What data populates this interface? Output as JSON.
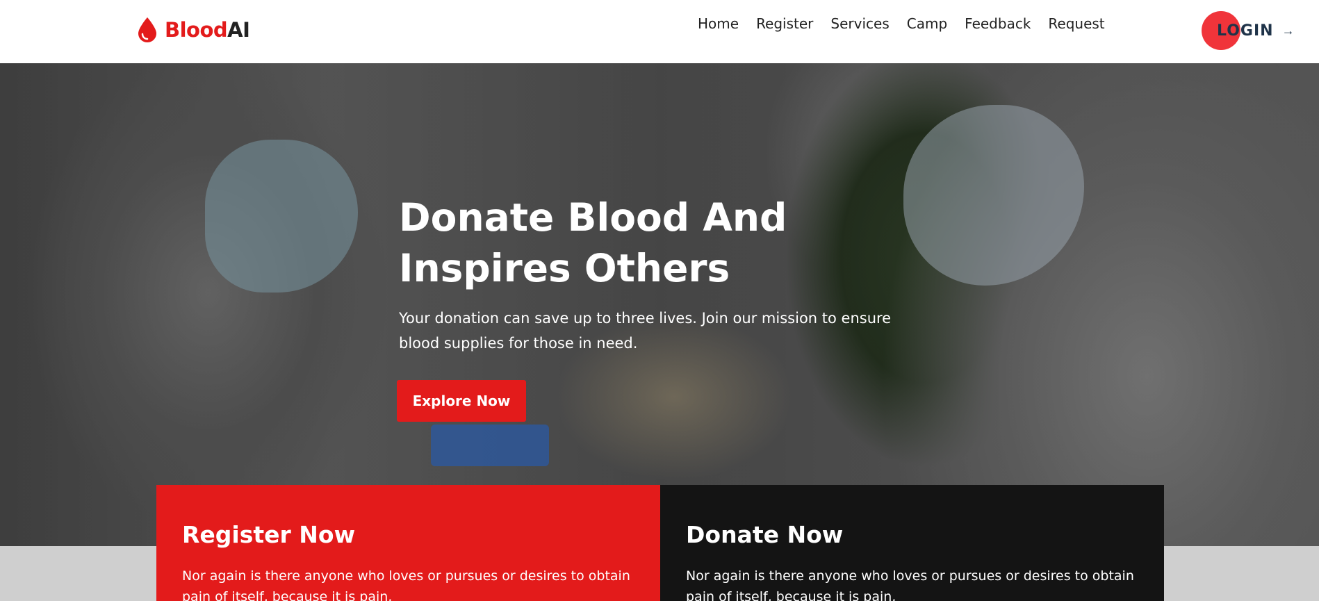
{
  "brand": {
    "name_primary": "Blood",
    "name_secondary": "AI",
    "icon": "blood-drop-icon",
    "accent_color": "#e31b1b"
  },
  "nav": {
    "items": [
      {
        "label": "Home"
      },
      {
        "label": "Register"
      },
      {
        "label": "Services"
      },
      {
        "label": "Camp"
      },
      {
        "label": "Feedback"
      },
      {
        "label": "Request"
      }
    ]
  },
  "login": {
    "label": "LOGIN",
    "arrow": "→",
    "icon": "arrow-right-icon"
  },
  "hero": {
    "title_line1": "Donate Blood And",
    "title_line2": "Inspires Others",
    "subtitle": "Your donation can save up to three lives. Join our mission to ensure blood supplies for those in need.",
    "cta_label": "Explore Now"
  },
  "cards": [
    {
      "title": "Register Now",
      "text": "Nor again is there anyone who loves or pursues or desires to obtain pain of itself, because it is pain,",
      "background": "#e31b1b"
    },
    {
      "title": "Donate Now",
      "text": "Nor again is there anyone who loves or pursues or desires to obtain pain of itself, because it is pain,",
      "background": "#141414"
    }
  ]
}
